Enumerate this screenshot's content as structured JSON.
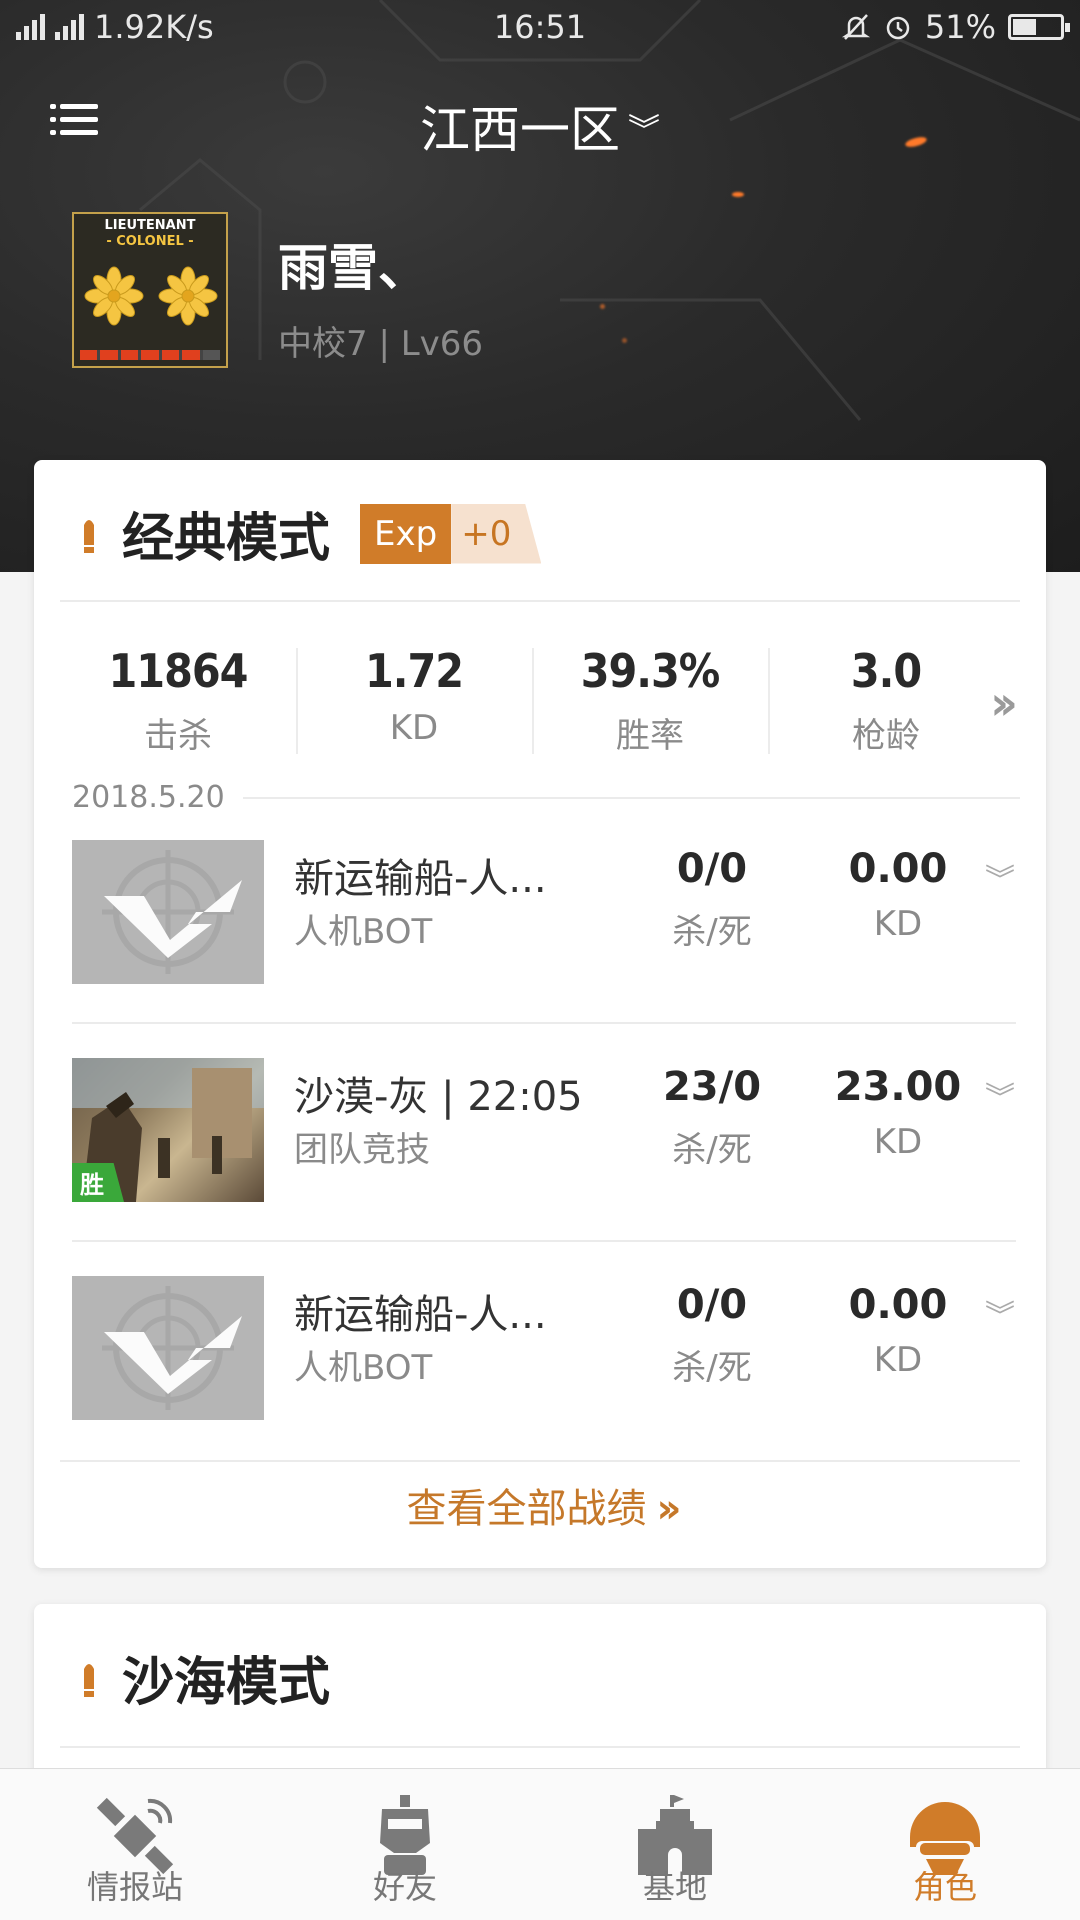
{
  "status_bar": {
    "net_types": "2G 4G 4G",
    "speed": "1.92K/s",
    "time": "16:51",
    "battery": "51%",
    "battery_level": 0.51
  },
  "header": {
    "server": "江西一区"
  },
  "profile": {
    "rank_badge_line1": "LIEUTENANT",
    "rank_badge_line2": "- COLONEL -",
    "name": "雨雪、",
    "rank_level": "中校7 | Lv66",
    "rank_progress_segments": 6,
    "rank_progress_total": 7
  },
  "classic": {
    "title": "经典模式",
    "exp_label": "Exp",
    "exp_value": "+0",
    "stats": [
      {
        "value": "11864",
        "label": "击杀"
      },
      {
        "value": "1.72",
        "label": "KD"
      },
      {
        "value": "39.3%",
        "label": "胜率"
      },
      {
        "value": "3.0",
        "label": "枪龄"
      }
    ],
    "date": "2018.5.20",
    "matches": [
      {
        "map": "新运输船-人...",
        "mode": "人机BOT",
        "kills_deaths": "0/0",
        "kd_label1": "杀/死",
        "kd": "0.00",
        "kd_label2": "KD",
        "thumb": "cf-logo-icon",
        "win": ""
      },
      {
        "map": "沙漠-灰 | 22:05",
        "mode": "团队竞技",
        "kills_deaths": "23/0",
        "kd_label1": "杀/死",
        "kd": "23.00",
        "kd_label2": "KD",
        "thumb": "desert-map-image",
        "win": "胜"
      },
      {
        "map": "新运输船-人...",
        "mode": "人机BOT",
        "kills_deaths": "0/0",
        "kd_label1": "杀/死",
        "kd": "0.00",
        "kd_label2": "KD",
        "thumb": "cf-logo-icon",
        "win": ""
      }
    ],
    "view_all": "查看全部战绩"
  },
  "sand": {
    "title": "沙海模式"
  },
  "tabs": [
    {
      "label": "情报站",
      "icon": "satellite-icon"
    },
    {
      "label": "好友",
      "icon": "robot-icon"
    },
    {
      "label": "基地",
      "icon": "castle-icon"
    },
    {
      "label": "角色",
      "icon": "helmet-icon"
    }
  ],
  "colors": {
    "accent": "#d07c29",
    "header_bg": "#2a2a2a",
    "win_green": "#3aa83a"
  }
}
